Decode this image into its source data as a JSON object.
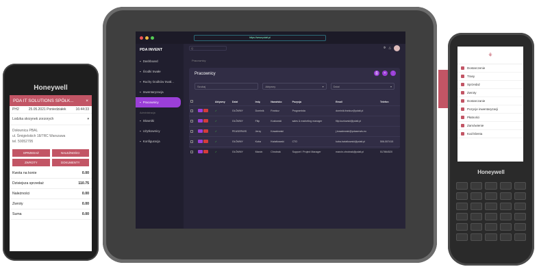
{
  "left_phone": {
    "brand": "Honeywell",
    "title": "PDA IT SOLUTIONS SPÓŁK...",
    "close": "×",
    "meta": [
      "PH2",
      "25.05.2021 Poniedziałek",
      "16:44:33"
    ],
    "location": "Lodzka skrzynek zorzorych",
    "address": [
      "Dołownica PBAL",
      "ul. Śmigielskich 18/7RC Warszawa",
      "tel. 50052795"
    ],
    "buttons": [
      "SPRZEDAŻ",
      "NALEŻNOŚCI",
      "ZWROTY",
      "DOKUMENTY"
    ],
    "stats": [
      {
        "label": "Kwota na konie",
        "value": "0.00"
      },
      {
        "label": "Dzisiejsza sprzedaż",
        "value": "110.75"
      },
      {
        "label": "Należności",
        "value": "0.00"
      },
      {
        "label": "Zwroty",
        "value": "0.00"
      },
      {
        "label": "Suma",
        "value": "0.00"
      }
    ]
  },
  "tablet": {
    "url": "https://www.pdait.pl",
    "logo": "PDA INVENT",
    "search_placeholder": "Q",
    "sidebar": [
      {
        "label": "Dashboard"
      },
      {
        "label": "Środki trwałe"
      },
      {
        "label": "Ruchy środków trwał..."
      },
      {
        "label": "Inwentaryzacja"
      },
      {
        "label": "Pracownicy",
        "active": true
      }
    ],
    "admin_heading": "Administracja",
    "admin_items": [
      {
        "label": "Słowniki"
      },
      {
        "label": "Użytkownicy"
      },
      {
        "label": "Konfiguracja"
      }
    ],
    "breadcrumb": "Pracownicy",
    "card_title": "Pracownicy",
    "filters": [
      "Szukaj",
      "Aktywny",
      "Dział"
    ],
    "columns": [
      "",
      "",
      "Aktywny",
      "Dział",
      "Imię",
      "Nazwisko",
      "Pozycja",
      "Email",
      "Telefon"
    ],
    "rows": [
      [
        "GŁÓWNY",
        "Dominik",
        "Frankcz",
        "Programista",
        "dominik.frankcz@pdait.pl",
        ""
      ],
      [
        "GŁÓWNY",
        "Filip",
        "Kozłowski",
        "sales & marketing manager",
        "filip.kozlowski@pdait.pl",
        ""
      ],
      [
        "PEASERWIS",
        "Jerzy",
        "Kowalewski",
        "",
        "j.kowalewski@pdaserwis.eu",
        ""
      ],
      [
        "GŁÓWNY",
        "Kuba",
        "Kwiatkowski",
        "CTO",
        "kuba.kwiatkowski@pdait.pl",
        "506-557415"
      ],
      [
        "GŁÓWNY",
        "Marcin",
        "Chrobrak",
        "Support / Project Manager",
        "marcin.chrobrak@pdait.pl",
        "517864520"
      ]
    ]
  },
  "right_device": {
    "brand": "Honeywell",
    "side_label": "Honeywell",
    "menu": [
      "Dostarczenie",
      "Trasy",
      "Sprzedaż",
      "Zwroty",
      "Dostarczanie",
      "Pozycje inwentaryzacji",
      "Płatności",
      "Zamówienie",
      "Kod klienta"
    ]
  }
}
